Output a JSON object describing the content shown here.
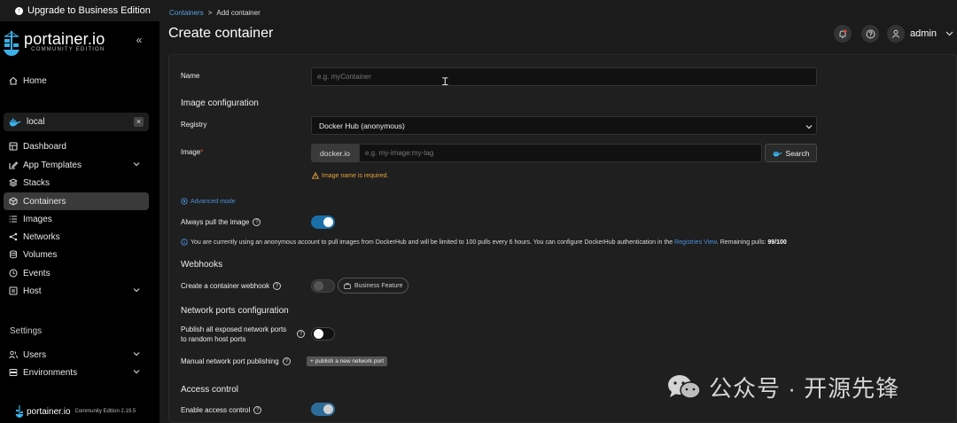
{
  "sidebar": {
    "upgrade_label": "Upgrade to Business Edition",
    "brand_name": "portainer.io",
    "brand_edition": "COMMUNITY EDITION",
    "collapse_glyph": "«",
    "home_label": "Home",
    "environment": {
      "name": "local",
      "close_glyph": "×"
    },
    "items": [
      {
        "label": "Dashboard",
        "icon": "dashboard-icon"
      },
      {
        "label": "App Templates",
        "icon": "edit-icon",
        "expandable": true
      },
      {
        "label": "Stacks",
        "icon": "stacks-icon"
      },
      {
        "label": "Containers",
        "icon": "container-icon",
        "active": true
      },
      {
        "label": "Images",
        "icon": "list-icon"
      },
      {
        "label": "Networks",
        "icon": "network-icon"
      },
      {
        "label": "Volumes",
        "icon": "database-icon"
      },
      {
        "label": "Events",
        "icon": "clock-icon"
      },
      {
        "label": "Host",
        "icon": "host-icon",
        "expandable": true
      }
    ],
    "settings_label": "Settings",
    "settings_items": [
      {
        "label": "Users",
        "icon": "users-icon",
        "expandable": true
      },
      {
        "label": "Environments",
        "icon": "environments-icon",
        "expandable": true
      }
    ],
    "footer_brand": "portainer.io",
    "footer_edition": "Community Edition 2.19.5"
  },
  "header": {
    "breadcrumb_link": "Containers",
    "breadcrumb_sep": ">",
    "breadcrumb_current": "Add container",
    "title": "Create container",
    "user": "admin"
  },
  "form": {
    "name_label": "Name",
    "name_placeholder": "e.g. myContainer",
    "image_config_title": "Image configuration",
    "registry_label": "Registry",
    "registry_value": "Docker Hub (anonymous)",
    "image_label": "Image",
    "image_required_mark": "*",
    "image_prefix": "docker.io",
    "image_placeholder": "e.g. my-image:my-tag",
    "search_button": "Search",
    "image_warning": "Image name is required.",
    "advanced_mode": "Advanced mode",
    "always_pull_label": "Always pull the image",
    "always_pull_on": true,
    "info_text": "You are currently using an anonymous account to pull images from DockerHub and will be limited to 100 pulls every 6 hours. You can configure DockerHub authentication in the",
    "info_link": "Registries View",
    "info_suffix": ". Remaining pulls:",
    "info_pulls": "99/100",
    "webhooks_title": "Webhooks",
    "webhook_label": "Create a container webhook",
    "business_feature": "Business Feature",
    "network_title": "Network ports configuration",
    "publish_all_label_1": "Publish all exposed network ports",
    "publish_all_label_2": "to random host ports",
    "publish_all_on": false,
    "manual_publish_label": "Manual network port publishing",
    "publish_new_button": "publish a new network port",
    "access_title": "Access control",
    "enable_access_label": "Enable access control",
    "enable_access_on": true
  },
  "watermark": {
    "text": "公众号 · 开源先锋"
  },
  "colors": {
    "accent": "#1b6fa8",
    "link": "#4a90d9",
    "warning": "#e6a23c"
  }
}
